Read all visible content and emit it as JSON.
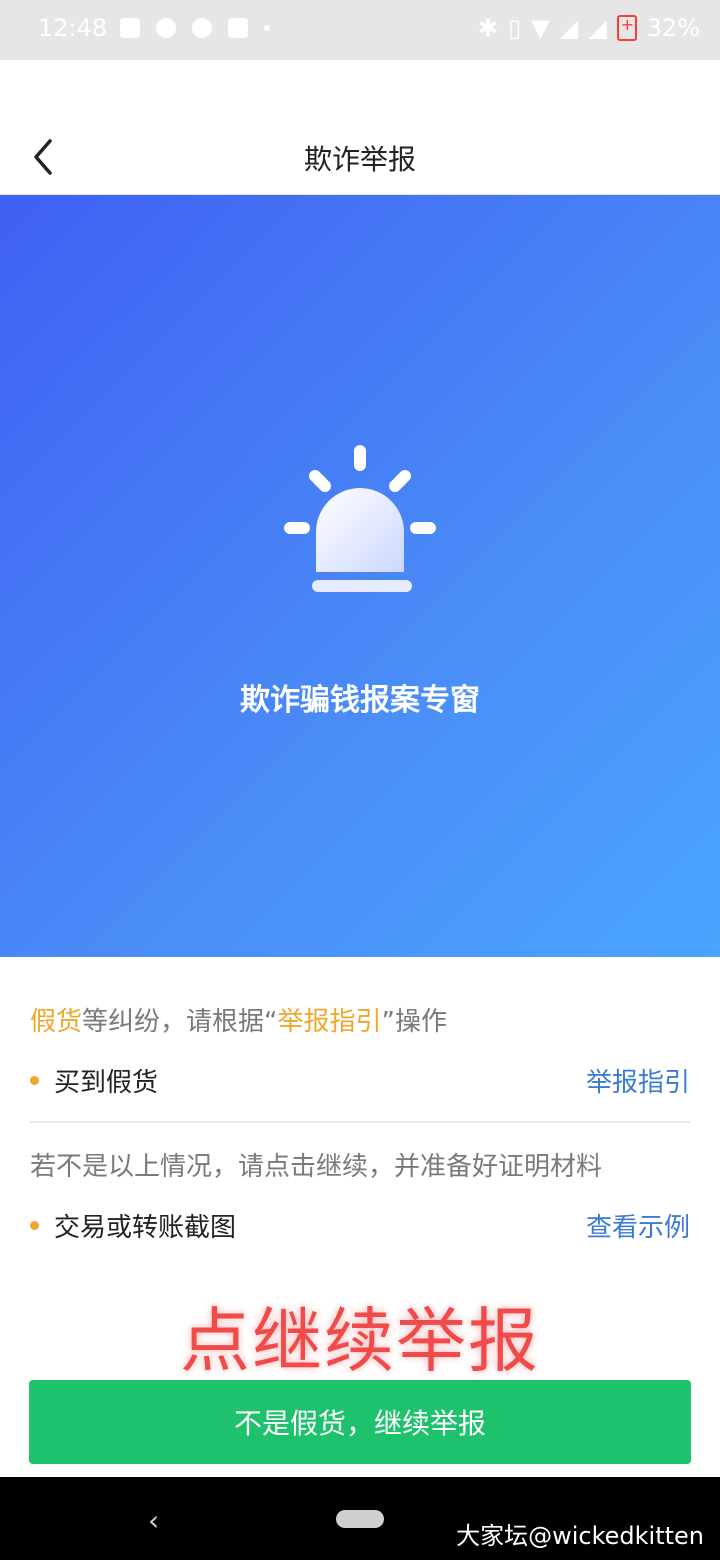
{
  "status_bar": {
    "time": "12:48",
    "battery": "32%"
  },
  "header": {
    "title": "欺诈举报"
  },
  "hero": {
    "title": "欺诈骗钱报案专窗",
    "icon": "siren-alarm-icon"
  },
  "notice1": {
    "prefix": "假货",
    "middle": "等纠纷，请根据",
    "quote_open": "“",
    "guide": "举报指引",
    "quote_close": "”",
    "suffix": "操作"
  },
  "row1": {
    "label": "买到假货",
    "link": "举报指引"
  },
  "notice2": "若不是以上情况，请点击继续，并准备好证明材料",
  "row2": {
    "label": "交易或转账截图",
    "link": "查看示例"
  },
  "overlay_text": "点继续举报",
  "continue_button": "不是假货，继续举报",
  "nav": {
    "back": "‹"
  },
  "watermark": "大家坛@wickedkitten",
  "colors": {
    "accent_orange": "#f0a62a",
    "link_blue": "#3b7bd4",
    "button_green": "#1ec26c",
    "hero_start": "#3f60f3",
    "hero_end": "#4aa5ff"
  }
}
